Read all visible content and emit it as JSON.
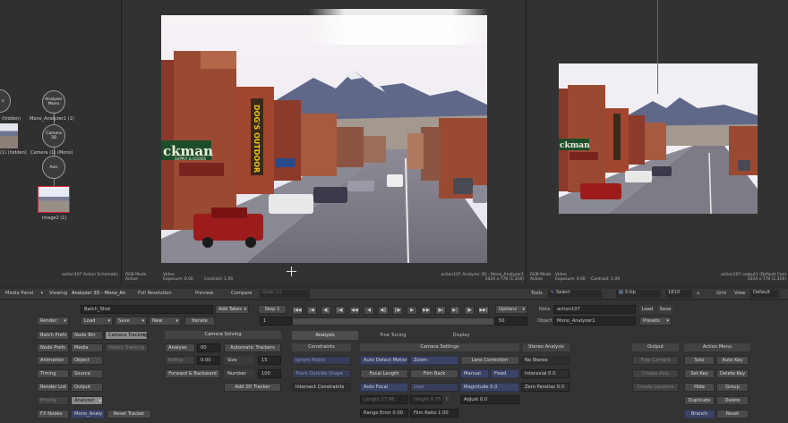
{
  "schematic": {
    "node_analyzer": "Analyzer\nMono",
    "node_analyzer_label": "Mono_Analyzer1 (1)",
    "node_camera": "Camera\n3D",
    "node_camera_label": "Camera (1) (Mono)",
    "node_axis": "Axis",
    "node_image_label": "image2 (1)",
    "left_hidden1": "(hidden)",
    "left_hidden2": "(1) (hidden)",
    "left_s": "s",
    "footer": "action107 Action Schematic"
  },
  "viewer_main": {
    "rgb_mode": "RGB Mode\nActive",
    "video": "Video\nExposure: 0.00",
    "contrast": "Contrast: 1.00",
    "info": "action107 Analyzer 3D - Mono_Analyzer1\n1024 x 778 (1.316)",
    "sign_left": "ckman",
    "sign_vertical": "DOG'S OUTDOOR",
    "sign_small": "SUPPLY & GOODS"
  },
  "viewer_right": {
    "rgb_mode": "RGB Mode\nActive",
    "video": "Video\nExposure: 0.00",
    "contrast": "Contrast: 1.00",
    "info": "action107 output1 (Default Cam\n1024 x 778 (1.316)",
    "sign_left": "ckman"
  },
  "toolbar": {
    "media_panel": "Media Panel",
    "viewing": "Viewing",
    "viewing_value": "Analyzer 3D - Mono_An",
    "full_resolution": "Full Resolution",
    "preview": "Preview",
    "compare": "Compare",
    "grab": "Grab (1)",
    "tools": "Tools",
    "select": "Select",
    "view_mode": "3-Up",
    "frame": "1810",
    "grid": "Grid",
    "view": "View",
    "default": "Default"
  },
  "batch": {
    "name": "Batch_Shot",
    "add_takes": "Add Takes",
    "step": "Step 1",
    "frame_field": "1",
    "frame_end": "50",
    "options": "Options",
    "note_label": "Note",
    "note_value": "action107",
    "load": "Load",
    "save": "Save",
    "object_label": "Object",
    "object_value": "Mono_Analyzer1",
    "presets": "Presets",
    "render": "Render",
    "load2": "Load",
    "save2": "Save",
    "new": "New",
    "iterate": "Iterate"
  },
  "transport": [
    "|◀◀",
    "|◀",
    "◀|",
    "|◀|",
    "◀◀",
    "◀",
    "◀||",
    "||▶",
    "▶",
    "▶▶",
    "|▶|",
    "▶|",
    "|▶",
    "▶▶|"
  ],
  "left_panel": {
    "rows": [
      [
        "Batch Prefs",
        "Node Bin"
      ],
      [
        "Node Prefs",
        "Media"
      ],
      [
        "Animation",
        "Object"
      ],
      [
        "Timing",
        "Source"
      ],
      [
        "Render List",
        "Output"
      ],
      [
        "Priority",
        "Analyzer"
      ],
      [
        "FX Nodes",
        "Mono_Analy"
      ]
    ],
    "camera_tracking": "Camera Tracking",
    "object_tracking": "Object Tracking",
    "reset_tracker": "Reset Tracker"
  },
  "camera_solving": {
    "header": "Camera Solving",
    "analyse": "Analyse",
    "analyse_val": "00",
    "automatic_trackers": "Automatic Trackers",
    "refine": "Refine",
    "refine_val": "0.00",
    "size": "Size",
    "size_val": "15",
    "forward_backward": "Forward & Backward",
    "number": "Number",
    "number_val": "100",
    "add_2d_tracker": "Add 2D Tracker"
  },
  "analysis": {
    "tabs": [
      "Analysis",
      "Fine Tuning",
      "Display"
    ],
    "constraints": "Constraints",
    "ignore_mattes": "Ignore Matte",
    "track_outside_shape": "Track Outside Shape",
    "intersect_constraints": "Intersect Constraints"
  },
  "camera_settings": {
    "header": "Camera Settings",
    "auto_detect_motion": "Auto Detect Motion",
    "zoom": "Zoom",
    "lens_correction": "Lens Correction",
    "focal_length": "Focal Length",
    "film_back": "Film Back",
    "manual": "Manual",
    "fixed": "Fixed",
    "auto_focal": "Auto Focal",
    "user": "User",
    "magnitude": "Magnitude 0.0",
    "length": "Length 27.86",
    "height": "Height 0.75",
    "adjust": "Adjust 0.0",
    "range_error": "Range Error 0.00",
    "film_ratio": "Film Ratio 1.00",
    "c": "C"
  },
  "stereo": {
    "header": "Stereo Analysis",
    "no_stereo": "No Stereo",
    "interaxial": "Interaxial 0.0",
    "zero_parallax": "Zero Parallax 0.0"
  },
  "output": {
    "header": "Output",
    "free_camera": "Free Camera",
    "create_axis": "Create Axis",
    "create_locators": "Create Locators"
  },
  "action_menu": {
    "header": "Action Menu",
    "items": [
      [
        "Solo",
        "Auto Key"
      ],
      [
        "Set Key",
        "Delete Key"
      ],
      [
        "Hide",
        "Group"
      ],
      [
        "Duplicate",
        "Delete"
      ],
      [
        "Branch",
        "Reset"
      ]
    ]
  }
}
